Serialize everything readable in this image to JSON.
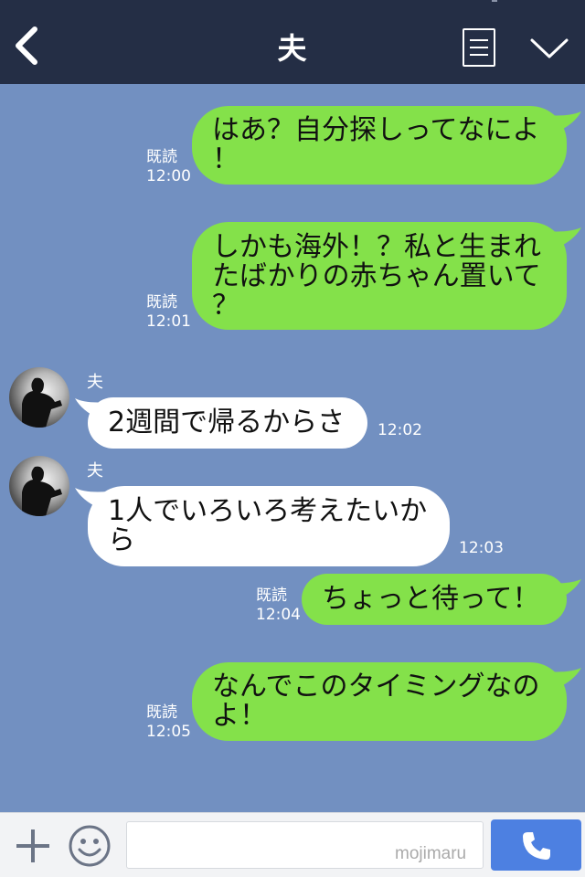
{
  "header": {
    "title": "夫",
    "back_icon": "chevron-left-icon",
    "notes_icon": "note-icon",
    "collapse_icon": "chevron-down-icon"
  },
  "colors": {
    "header_bg": "#242e45",
    "chat_bg": "#7290c1",
    "outgoing_bubble": "#84e14a",
    "incoming_bubble": "#ffffff",
    "call_button": "#4d80e1"
  },
  "messages": [
    {
      "direction": "out",
      "lines": [
        "はあ？自分探しってなによ",
        "！"
      ],
      "read": "既読",
      "time": "12:00"
    },
    {
      "direction": "out",
      "lines": [
        "しかも海外！？私と生まれ",
        "たばかりの赤ちゃん置いて",
        "？"
      ],
      "read": "既読",
      "time": "12:01"
    },
    {
      "direction": "in",
      "sender": "夫",
      "lines": [
        "2週間で帰るからさ"
      ],
      "time": "12:02"
    },
    {
      "direction": "in",
      "sender": "夫",
      "lines": [
        "1人でいろいろ考えたいか",
        "ら"
      ],
      "time": "12:03"
    },
    {
      "direction": "out",
      "lines": [
        "ちょっと待って！"
      ],
      "read": "既読",
      "time": "12:04"
    },
    {
      "direction": "out",
      "lines": [
        "なんでこのタイミングなの",
        "よ！"
      ],
      "read": "既読",
      "time": "12:05"
    }
  ],
  "input_bar": {
    "plus_icon": "plus-icon",
    "emoji_icon": "smiley-icon",
    "input_value": "",
    "watermark": "mojimaru",
    "call_icon": "phone-icon"
  }
}
